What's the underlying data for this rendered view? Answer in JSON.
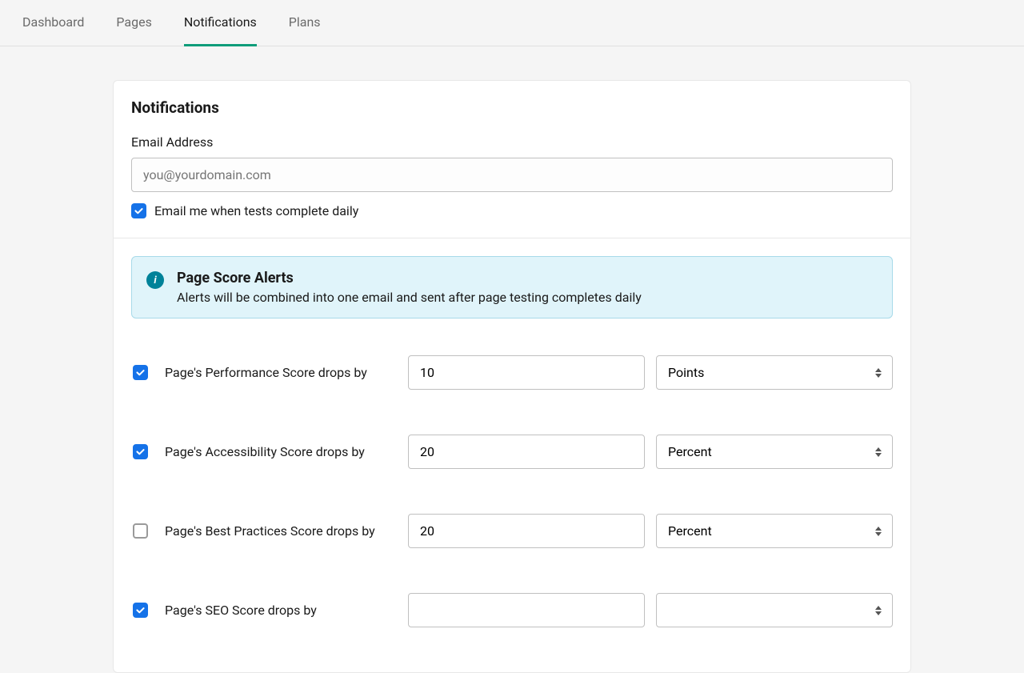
{
  "nav": {
    "tabs": [
      {
        "label": "Dashboard",
        "active": false
      },
      {
        "label": "Pages",
        "active": false
      },
      {
        "label": "Notifications",
        "active": true
      },
      {
        "label": "Plans",
        "active": false
      }
    ]
  },
  "page": {
    "title": "Notifications",
    "email_label": "Email Address",
    "email_placeholder": "you@yourdomain.com",
    "email_value": "",
    "daily_checkbox_label": "Email me when tests complete daily",
    "daily_checkbox_checked": true
  },
  "banner": {
    "title": "Page Score Alerts",
    "text": "Alerts will be combined into one email and sent after page testing completes daily"
  },
  "unit_options": [
    "Points",
    "Percent"
  ],
  "alerts": [
    {
      "checked": true,
      "label": "Page's Performance Score drops by",
      "value": "10",
      "unit": "Points"
    },
    {
      "checked": true,
      "label": "Page's Accessibility Score drops by",
      "value": "20",
      "unit": "Percent"
    },
    {
      "checked": false,
      "label": "Page's Best Practices Score drops by",
      "value": "20",
      "unit": "Percent"
    },
    {
      "checked": true,
      "label": "Page's SEO Score drops by",
      "value": "",
      "unit": ""
    }
  ]
}
